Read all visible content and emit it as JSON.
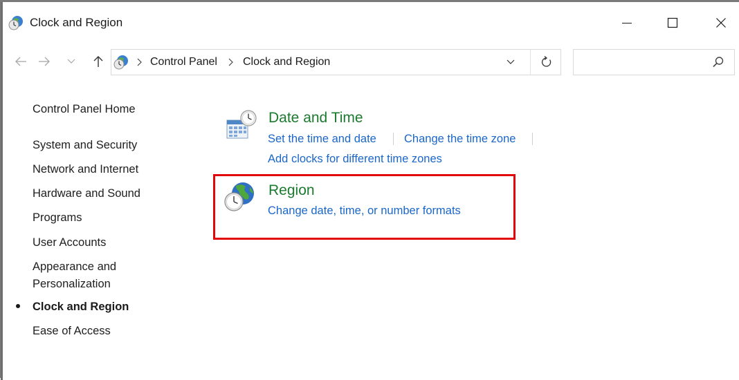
{
  "window": {
    "title": "Clock and Region",
    "icon": "clock-globe-icon"
  },
  "caption_buttons": {
    "minimize_icon": "minimize-icon",
    "maximize_icon": "maximize-icon",
    "close_icon": "close-icon"
  },
  "navigation": {
    "back_icon": "arrow-left-icon",
    "forward_icon": "arrow-right-icon",
    "recent_icon": "chevron-down-icon",
    "up_icon": "arrow-up-icon"
  },
  "address_bar": {
    "breadcrumbs": [
      "Control Panel",
      "Clock and Region"
    ],
    "dropdown_icon": "chevron-down-icon",
    "refresh_icon": "refresh-icon"
  },
  "search": {
    "value": "",
    "placeholder": "",
    "icon": "search-icon"
  },
  "sidebar": {
    "items": [
      {
        "label": "Control Panel Home"
      },
      {
        "label": "System and Security"
      },
      {
        "label": "Network and Internet"
      },
      {
        "label": "Hardware and Sound"
      },
      {
        "label": "Programs"
      },
      {
        "label": "User Accounts"
      },
      {
        "label": "Appearance and"
      },
      {
        "label": "Personalization"
      },
      {
        "label": "Clock and Region"
      },
      {
        "label": "Ease of Access"
      }
    ],
    "active_item": "Clock and Region"
  },
  "categories": {
    "date_time": {
      "title": "Date and Time",
      "icon": "calendar-clock-icon",
      "links": [
        "Set the time and date",
        "Change the time zone",
        "Add clocks for different time zones"
      ]
    },
    "region": {
      "title": "Region",
      "icon": "globe-clock-icon",
      "links": [
        "Change date, time, or number formats"
      ]
    }
  },
  "colors": {
    "category_title": "#1a7a2e",
    "link": "#1a66c9",
    "highlight": "#e0060a"
  }
}
